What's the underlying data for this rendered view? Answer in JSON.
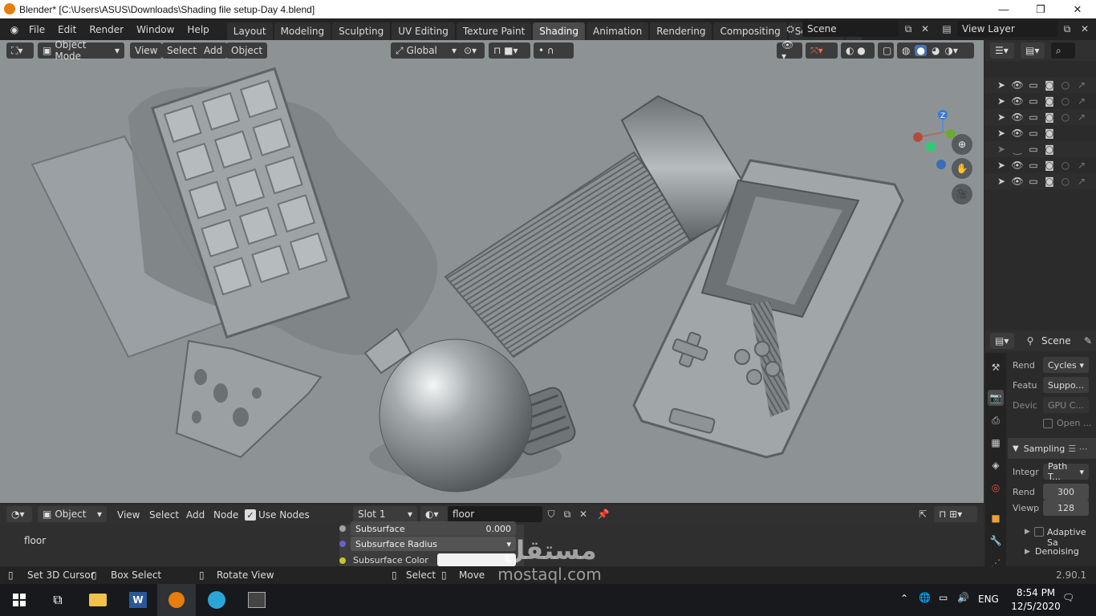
{
  "window": {
    "title": "Blender* [C:\\Users\\ASUS\\Downloads\\Shading file setup-Day 4.blend]",
    "min": "—",
    "max": "❐",
    "close": "✕"
  },
  "menus": [
    "File",
    "Edit",
    "Render",
    "Window",
    "Help"
  ],
  "workspaces": [
    "Layout",
    "Modeling",
    "Sculpting",
    "UV Editing",
    "Texture Paint",
    "Shading",
    "Animation",
    "Rendering",
    "Compositing",
    "Scripting"
  ],
  "active_workspace": "Shading",
  "add_workspace": "+",
  "scene": {
    "label": "Scene"
  },
  "view_layer": {
    "label": "View Layer"
  },
  "viewport": {
    "mode": "Object Mode",
    "menus": [
      "View",
      "Select",
      "Add",
      "Object"
    ],
    "orientation": "Global",
    "gizmo": {
      "z": "Z",
      "x": "X"
    }
  },
  "properties": {
    "scene_label": "Scene",
    "render_label": "Rend",
    "render_engine": "Cycles",
    "feature_label": "Featu",
    "feature_value": "Suppo...",
    "device_label": "Devic",
    "device_value": "GPU C...",
    "open_label": "Open ...",
    "sampling": "Sampling",
    "integrator_label": "Integr",
    "integrator_value": "Path T...",
    "render_samples_label": "Rend",
    "render_samples": "300",
    "viewport_samples_label": "Viewp",
    "viewport_samples": "128",
    "adaptive": "Adaptive Sa",
    "denoising": "Denoising"
  },
  "node_editor": {
    "type": "Object",
    "menus": [
      "View",
      "Select",
      "Add",
      "Node"
    ],
    "use_nodes": "Use Nodes",
    "slot": "Slot 1",
    "material": "floor",
    "breadcrumb": "floor",
    "subsurface_label": "Subsurface",
    "subsurface_value": "0.000",
    "subsurface_radius": "Subsurface Radius",
    "subsurface_color": "Subsurface Color"
  },
  "statusbar": {
    "set_cursor": "Set 3D Cursor",
    "box_select": "Box Select",
    "rotate_view": "Rotate View",
    "select": "Select",
    "move": "Move",
    "version": "2.90.1"
  },
  "taskbar": {
    "lang": "ENG",
    "time": "8:54 PM",
    "date": "12/5/2020"
  },
  "watermark": {
    "brand": "مستقل",
    "site": "mostaql.com"
  },
  "colors": {
    "accent": "#4772b3",
    "viewport_bg": "#8d9395",
    "header": "#303030"
  }
}
